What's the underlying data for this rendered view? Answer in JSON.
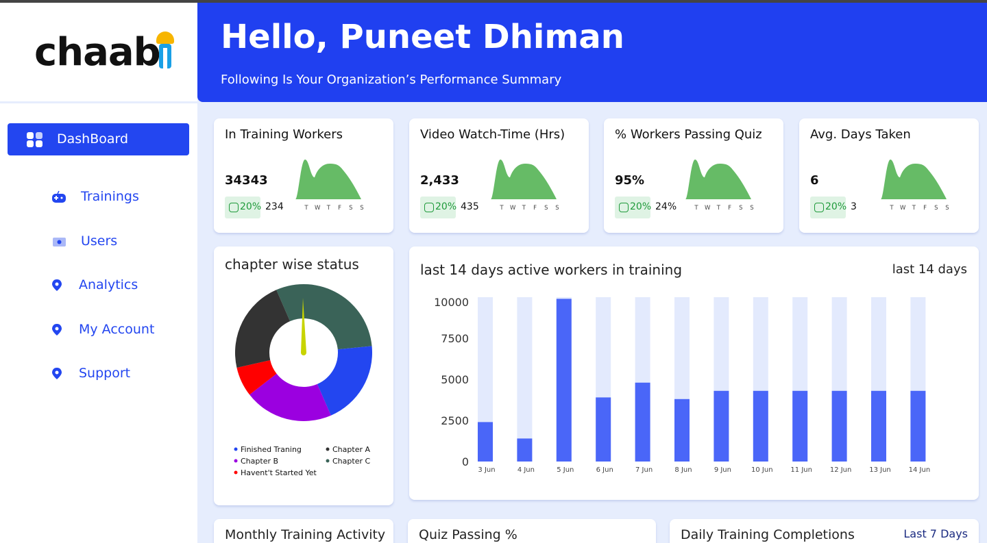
{
  "logo": {
    "text": "chaab"
  },
  "header": {
    "greeting": "Hello, Puneet Dhiman",
    "subtitle": "Following Is Your Organization’s Performance Summary"
  },
  "nav": {
    "active": {
      "label": "DashBoard",
      "icon": "grid-icon"
    },
    "items": [
      {
        "label": "Trainings",
        "icon": "gamepad-icon"
      },
      {
        "label": "Users",
        "icon": "ticket-icon"
      },
      {
        "label": "Analytics",
        "icon": "location-pin-icon"
      },
      {
        "label": "My Account",
        "icon": "location-pin-icon"
      },
      {
        "label": "Support",
        "icon": "location-pin-icon"
      }
    ]
  },
  "kpis": [
    {
      "title": "In Training Workers",
      "value": "34343",
      "badge": "20%",
      "sub": "234"
    },
    {
      "title": "Video Watch-Time (Hrs)",
      "value": "2,433",
      "badge": "20%",
      "sub": "435"
    },
    {
      "title": "% Workers Passing Quiz",
      "value": "95%",
      "badge": "20%",
      "sub": "24%"
    },
    {
      "title": "Avg. Days Taken",
      "value": "6",
      "badge": "20%",
      "sub": "3"
    }
  ],
  "spark_days": [
    "T",
    "W",
    "T",
    "F",
    "S",
    "S"
  ],
  "donut": {
    "title": "chapter wise status",
    "legend": [
      {
        "label": "Finished Traning",
        "color": "#2346f0"
      },
      {
        "label": "Chapter A",
        "color": "#333333"
      },
      {
        "label": "Chapter B",
        "color": "#9b00e0"
      },
      {
        "label": "Chapter C",
        "color": "#3a6358"
      },
      {
        "label": "Havent't Started Yet",
        "color": "#ff0000"
      }
    ]
  },
  "bar_card": {
    "title": "last 14 days active workers in training",
    "range": "last 14 days"
  },
  "bottom": {
    "monthly": "Monthly Training Activity",
    "quiz": "Quiz Passing %",
    "daily": "Daily Training Completions",
    "daily_range": "Last 7 Days"
  },
  "colors": {
    "accent": "#2040f0",
    "bar": "#4a66f8",
    "bar_bg": "#e3eafd",
    "spark": "#66bb66"
  },
  "chart_data": [
    {
      "type": "pie",
      "title": "chapter wise status",
      "labels": [
        "Chapter C",
        "Finished Traning",
        "Chapter B",
        "Havent't Started Yet",
        "Chapter A"
      ],
      "values": [
        30,
        20,
        21,
        7,
        22
      ],
      "colors": [
        "#3a6358",
        "#2346f0",
        "#9b00e0",
        "#ff0000",
        "#333333"
      ]
    },
    {
      "type": "bar",
      "title": "last 14 days active workers in training",
      "categories": [
        "3 Jun",
        "4 Jun",
        "5 Jun",
        "6 Jun",
        "7 Jun",
        "8 Jun",
        "9 Jun",
        "10 Jun",
        "11 Jun",
        "12 Jun",
        "13 Jun",
        "14 Jun"
      ],
      "values": [
        2400,
        1400,
        9900,
        3900,
        4800,
        3800,
        4300,
        4300,
        4300,
        4300,
        4300,
        4300
      ],
      "ylim": [
        0,
        10000
      ],
      "yticks": [
        0,
        2500,
        5000,
        7500,
        10000
      ]
    }
  ]
}
